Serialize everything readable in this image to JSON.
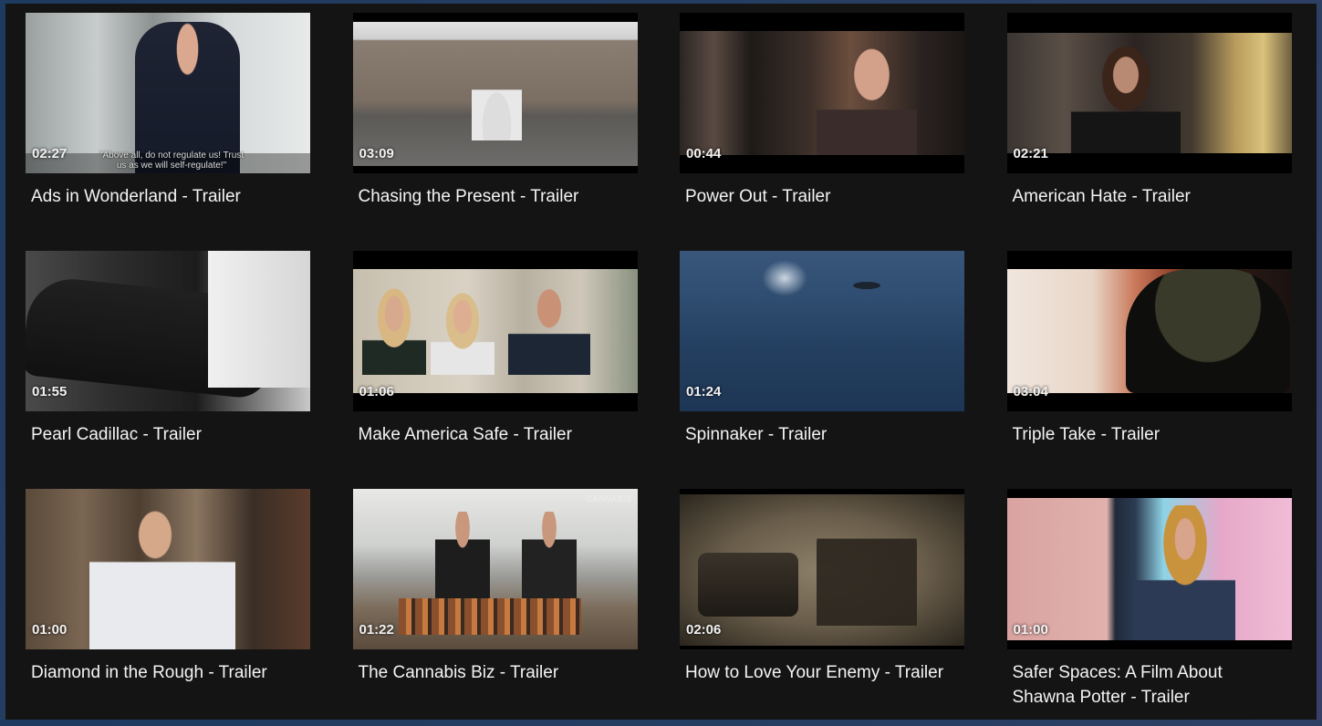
{
  "videos": [
    {
      "title": "Ads in Wonderland - Trailer",
      "duration": "02:27",
      "subtitle": "\"Above all, do not regulate us! Trust us as we will self-regulate!\""
    },
    {
      "title": "Chasing the Present - Trailer",
      "duration": "03:09"
    },
    {
      "title": "Power Out - Trailer",
      "duration": "00:44"
    },
    {
      "title": "American Hate - Trailer",
      "duration": "02:21"
    },
    {
      "title": "Pearl Cadillac - Trailer",
      "duration": "01:55"
    },
    {
      "title": "Make America Safe - Trailer",
      "duration": "01:06"
    },
    {
      "title": "Spinnaker - Trailer",
      "duration": "01:24"
    },
    {
      "title": "Triple Take - Trailer",
      "duration": "03:04"
    },
    {
      "title": "Diamond in the Rough - Trailer",
      "duration": "01:00"
    },
    {
      "title": "The Cannabis Biz - Trailer",
      "duration": "01:22",
      "logo": "CANNABIS"
    },
    {
      "title": "How to Love Your Enemy - Trailer",
      "duration": "02:06"
    },
    {
      "title": "Safer Spaces: A Film About Shawna Potter - Trailer",
      "duration": "01:00"
    }
  ],
  "colors": {
    "background": "#141414",
    "text": "#f4f4f4"
  }
}
